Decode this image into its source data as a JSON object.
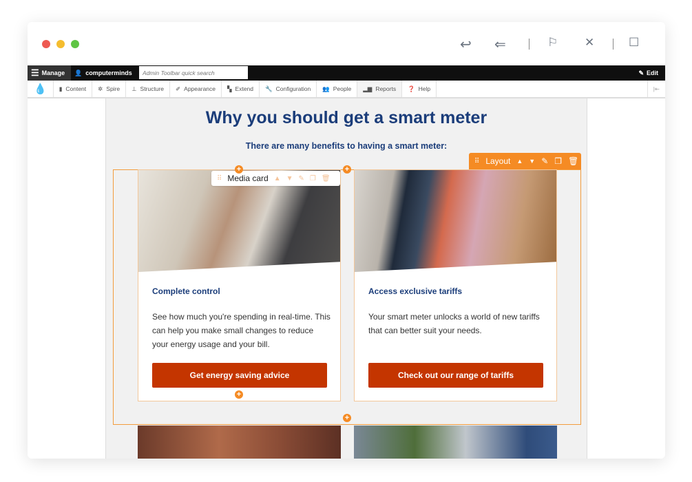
{
  "window": {
    "traffic_lights": [
      "#ee5a52",
      "#f5bd2f",
      "#5fc544"
    ],
    "icons": [
      "reply-icon",
      "reply-all-icon",
      "flag-icon",
      "close-icon",
      "compose-icon"
    ]
  },
  "admin_toolbar": {
    "manage": "Manage",
    "user": "computerminds",
    "search_placeholder": "Admin Toolbar quick search",
    "edit": "Edit"
  },
  "tray": {
    "items": [
      {
        "label": "Content",
        "icon": "content-icon"
      },
      {
        "label": "Spire",
        "icon": "spire-icon"
      },
      {
        "label": "Structure",
        "icon": "structure-icon"
      },
      {
        "label": "Appearance",
        "icon": "appearance-icon"
      },
      {
        "label": "Extend",
        "icon": "extend-icon"
      },
      {
        "label": "Configuration",
        "icon": "configuration-icon"
      },
      {
        "label": "People",
        "icon": "people-icon"
      },
      {
        "label": "Reports",
        "icon": "reports-icon"
      },
      {
        "label": "Help",
        "icon": "help-icon"
      }
    ]
  },
  "page": {
    "title": "Why you should get a smart meter",
    "subtitle": "There are many benefits to having a smart meter:"
  },
  "layout_bar": {
    "label": "Layout"
  },
  "media_card_bar": {
    "label": "Media card"
  },
  "accent": "#f58b24",
  "button_color": "#c43500",
  "cards": [
    {
      "title": "Complete control",
      "body": "See how much you're spending in real-time. This can help you make small changes to reduce your energy usage and your bill.",
      "button": "Get energy saving advice"
    },
    {
      "title": "Access exclusive tariffs",
      "body": "Your smart meter unlocks a world of new tariffs that can better suit your needs.",
      "button": "Check out our range of tariffs"
    }
  ]
}
